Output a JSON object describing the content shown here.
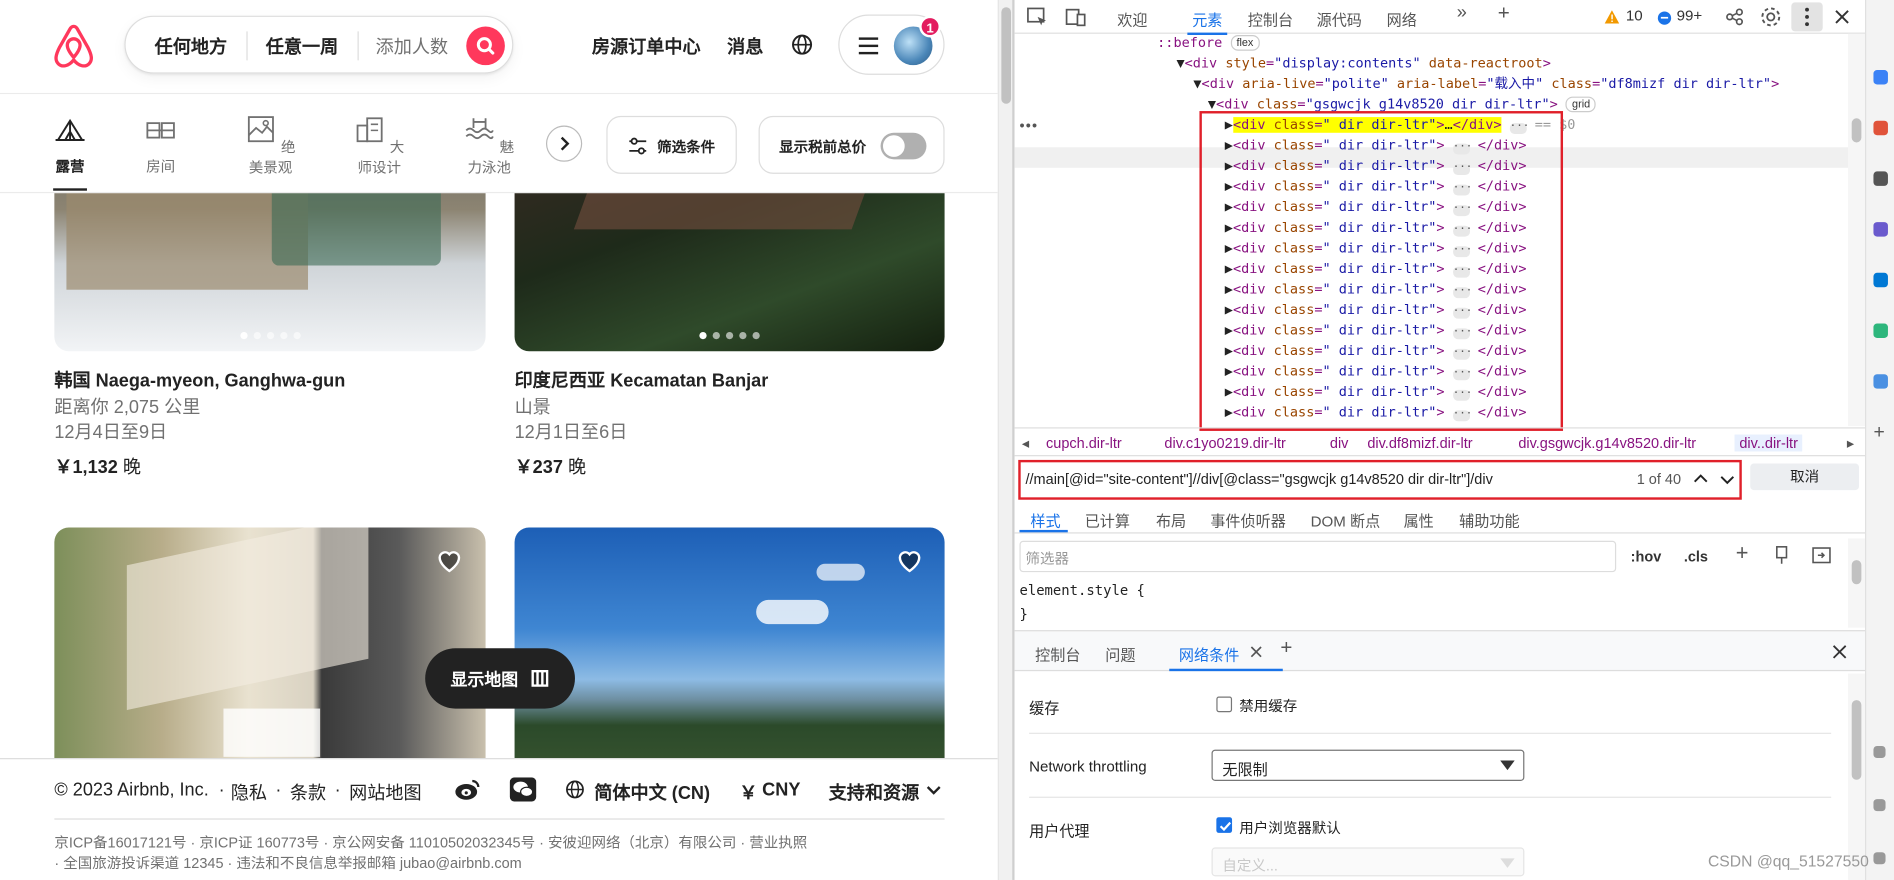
{
  "header": {
    "search_where": "任何地方",
    "search_when": "任意一周",
    "search_who_placeholder": "添加人数",
    "host_link": "房源订单中心",
    "messages_link": "消息",
    "notification_count": "1"
  },
  "categories": {
    "items": [
      {
        "label": "露营",
        "icon": "tent-icon"
      },
      {
        "label": "房间",
        "icon": "room-icon"
      },
      {
        "label": "绝美景观",
        "icon": "view-icon"
      },
      {
        "label": "大师设计",
        "icon": "design-icon"
      },
      {
        "label": "魅力泳池",
        "icon": "pool-icon"
      }
    ],
    "filter_label": "筛选条件",
    "tax_label": "显示税前总价"
  },
  "listings": [
    {
      "title": "韩国 Naega-myeon, Ganghwa-gun",
      "sub1": "距离你 2,075 公里",
      "sub2": "12月4日至9日",
      "price": "￥1,132",
      "unit": "晚"
    },
    {
      "title": "印度尼西亚 Kecamatan Banjar",
      "sub1": "山景",
      "sub2": "12月1日至6日",
      "price": "￥237",
      "unit": "晚"
    }
  ],
  "map_button": "显示地图",
  "footer": {
    "copyright": "© 2023 Airbnb, Inc.",
    "privacy": "隐私",
    "terms": "条款",
    "sitemap": "网站地图",
    "language": "简体中文 (CN)",
    "currency_symbol": "￥",
    "currency": "CNY",
    "support": "支持和资源",
    "icp_line1": "京ICP备16017121号 · 京ICP证 160773号 · 京公网安备 11010502032345号 · 安彼迎网络（北京）有限公司 · 营业执照",
    "icp_line2": "· 全国旅游投诉渠道 12345 · 违法和不良信息举报邮箱 jubao@airbnb.com"
  },
  "devtools": {
    "tabs": [
      "欢迎",
      "元素",
      "控制台",
      "源代码",
      "网络"
    ],
    "warnings": "10",
    "issues": "99+",
    "code": {
      "before": "::before",
      "flex": "flex",
      "grid": "grid",
      "line1_attr": "style",
      "line1_val": "\"display:contents\"",
      "line1_attr2": "data-reactroot",
      "line2_attr": "aria-live",
      "line2_val": "\"polite\"",
      "line2_attr2": "aria-label",
      "line2_val2": "\"载入中\"",
      "line2_attr3": "class",
      "line2_val3": "\"df8mizf dir dir-ltr\"",
      "line3_val": "\"gsgwcjk g14v8520 dir dir-ltr\"",
      "child_val": "\" dir dir-ltr\"",
      "eq": "== $0"
    },
    "breadcrumbs": [
      "cupch.dir-ltr",
      "div.c1yo0219.dir-ltr",
      "div",
      "div.df8mizf.dir-ltr",
      "div.gsgwcjk.g14v8520.dir-ltr",
      "div..dir-ltr"
    ],
    "xpath_query": "//main[@id=\"site-content\"]//div[@class=\"gsgwcjk g14v8520 dir dir-ltr\"]/div",
    "match_count": "1 of 40",
    "cancel": "取消",
    "style_tabs": [
      "样式",
      "已计算",
      "布局",
      "事件侦听器",
      "DOM 断点",
      "属性",
      "辅助功能"
    ],
    "filter_placeholder": "筛选器",
    "hov": ":hov",
    "cls": ".cls",
    "element_style_open": "element.style {",
    "element_style_close": "}",
    "drawer_tabs": [
      "控制台",
      "问题",
      "网络条件"
    ],
    "cache_label": "缓存",
    "disable_cache": "禁用缓存",
    "throttling_label": "Network throttling",
    "throttling_value": "无限制",
    "ua_label": "用户代理",
    "ua_default": "用户浏览器默认",
    "ua_custom_placeholder": "自定义..."
  },
  "watermark": "CSDN @qq_51527550",
  "colors": {
    "brand": "#ff385c",
    "devtools_accent": "#1a73e8",
    "highlight_box": "#e0202a"
  }
}
